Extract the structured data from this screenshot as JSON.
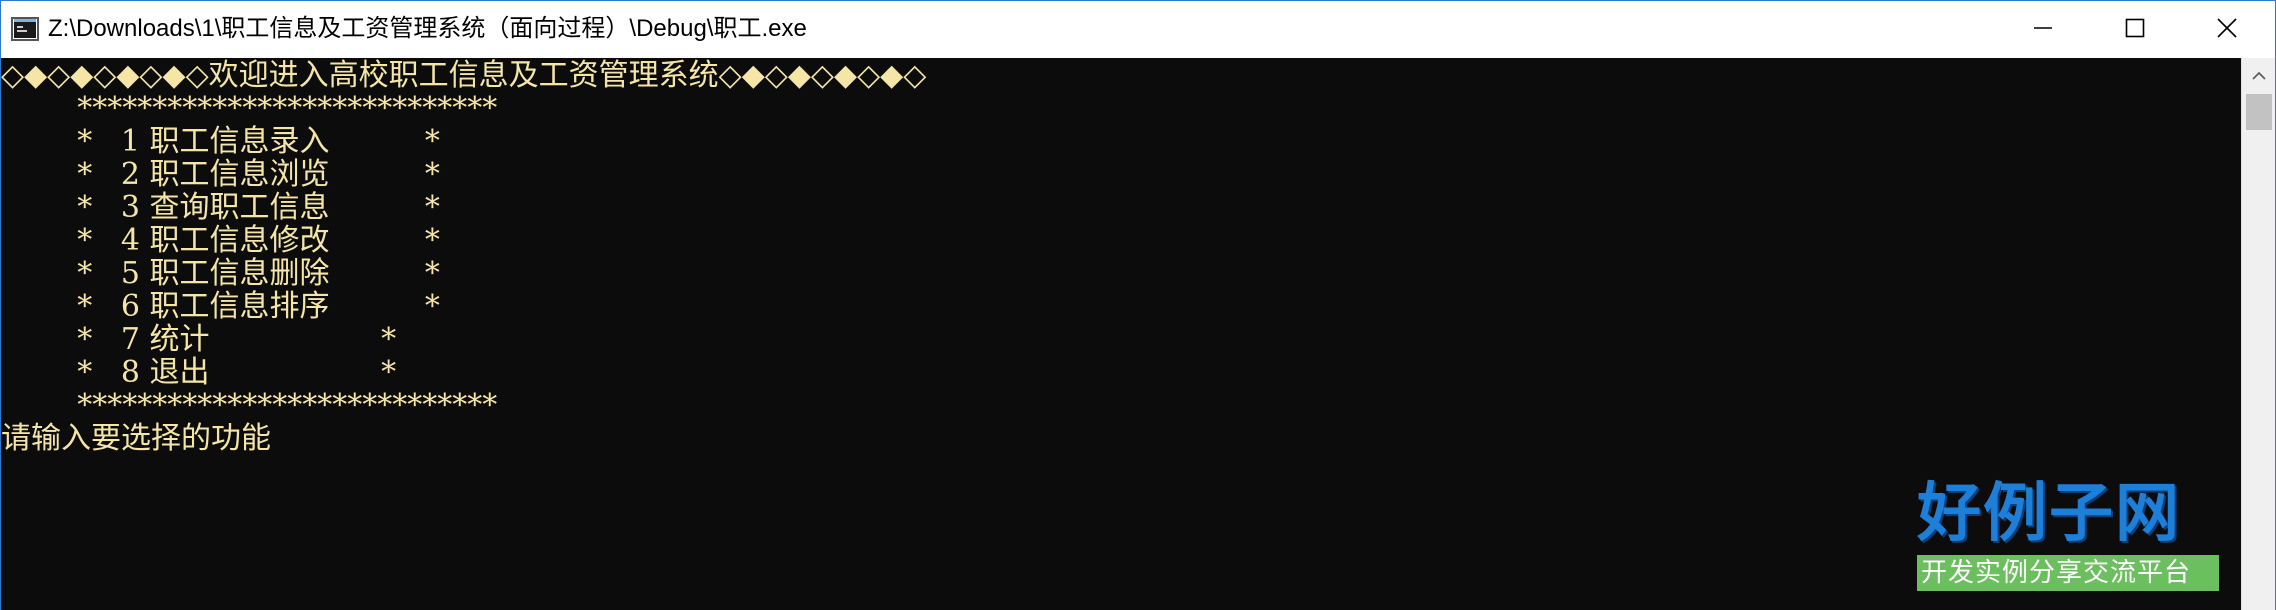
{
  "window": {
    "title": "Z:\\Downloads\\1\\职工信息及工资管理系统（面向过程）\\Debug\\职工.exe",
    "border_color": "#2b79d0"
  },
  "controls": {
    "minimize_icon": "minimize-icon",
    "maximize_icon": "maximize-icon",
    "close_icon": "close-icon"
  },
  "console": {
    "background": "#0c0c0c",
    "text_color": "#f5e6a8",
    "lines": [
      "◇◆◇◆◇◆◇◆◇欢迎进入高校职工信息及工资管理系统◇◆◇◆◇◆◇◆◇",
      "        ****************************",
      "        *   1 职工信息录入          *",
      "        *   2 职工信息浏览          *",
      "        *   3 查询职工信息          *",
      "        *   4 职工信息修改          *",
      "        *   5 职工信息删除          *",
      "        *   6 职工信息排序          *",
      "        *   7 统计                  *",
      "        *   8 退出                  *",
      "        ****************************",
      "请输入要选择的功能"
    ]
  },
  "watermark": {
    "title": "好例子网",
    "subtitle": "开发实例分享交流平台"
  }
}
